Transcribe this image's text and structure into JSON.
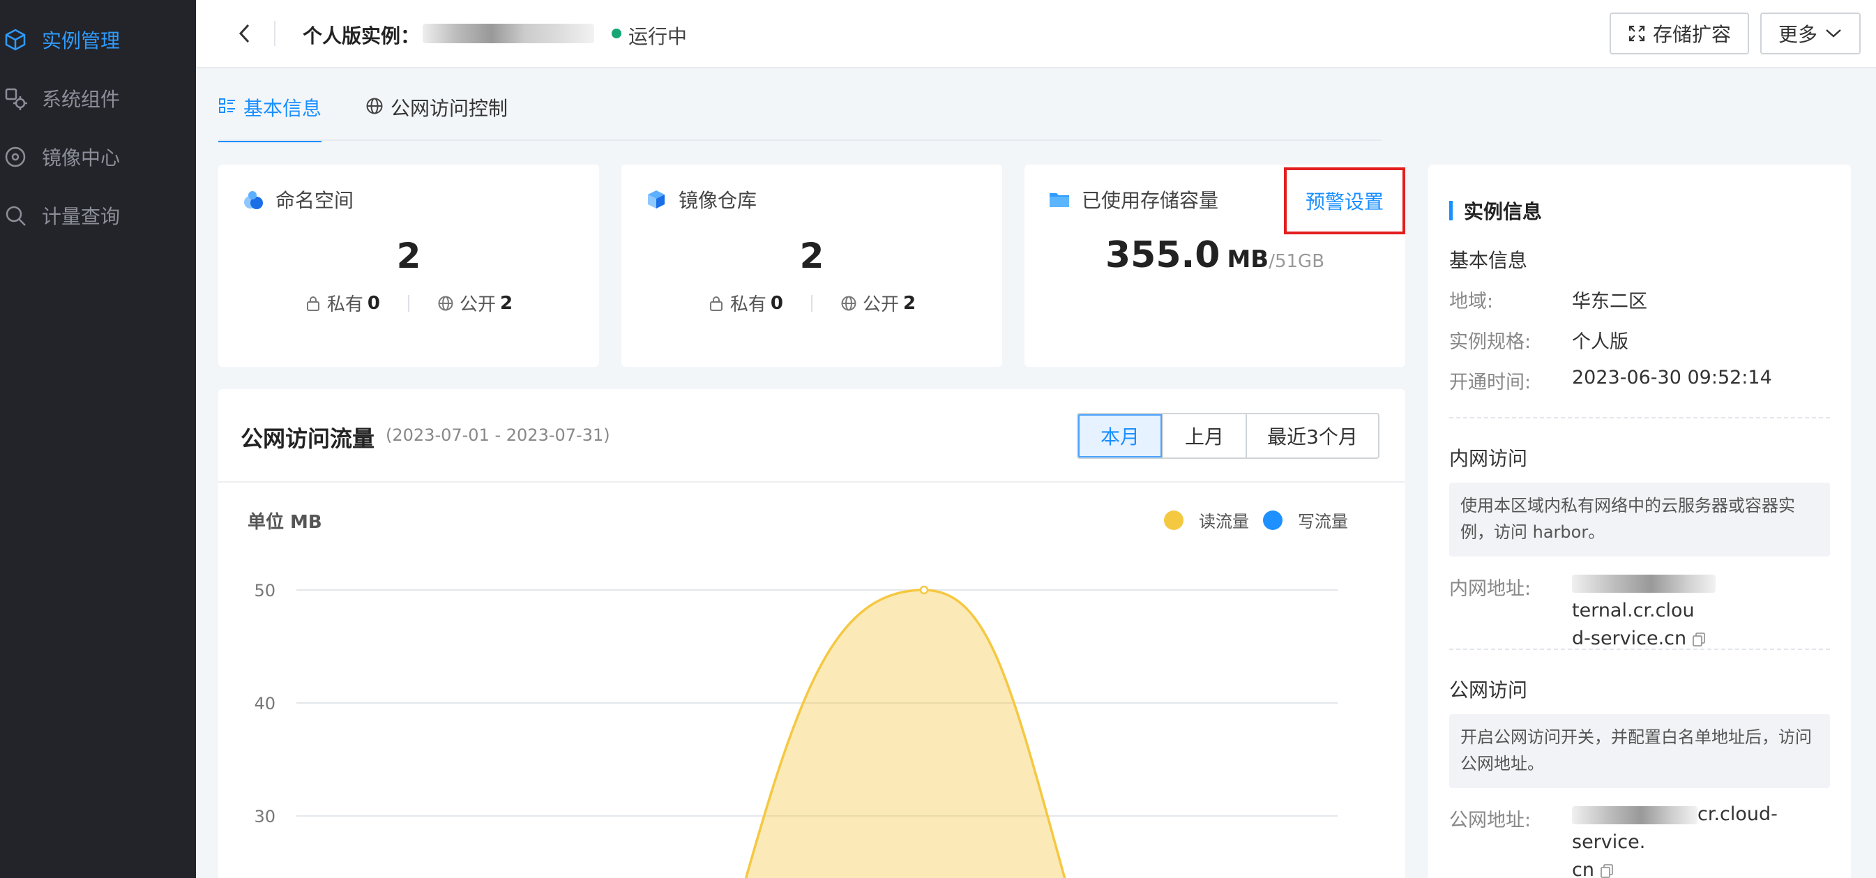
{
  "sidebar": {
    "items": [
      {
        "label": "实例管理",
        "icon": "instance-cube-icon",
        "active": true
      },
      {
        "label": "系统组件",
        "icon": "component-gear-icon",
        "active": false
      },
      {
        "label": "镜像中心",
        "icon": "image-disc-icon",
        "active": false
      },
      {
        "label": "计量查询",
        "icon": "search-icon",
        "active": false
      }
    ]
  },
  "header": {
    "title": "个人版实例：",
    "status": "运行中",
    "expand_label": "存储扩容",
    "more_label": "更多"
  },
  "tabs": [
    {
      "label": "基本信息",
      "icon": "list-icon",
      "active": true
    },
    {
      "label": "公网访问控制",
      "icon": "globe-icon",
      "active": false
    }
  ],
  "stats": {
    "namespace": {
      "title": "命名空间",
      "count": "2",
      "private_label": "私有",
      "private_count": "0",
      "public_label": "公开",
      "public_count": "2"
    },
    "repository": {
      "title": "镜像仓库",
      "count": "2",
      "private_label": "私有",
      "private_count": "0",
      "public_label": "公开",
      "public_count": "2"
    },
    "storage": {
      "title": "已使用存储容量",
      "alarm_link": "预警设置",
      "value": "355.0",
      "unit": "MB",
      "total": "/51GB"
    }
  },
  "traffic": {
    "title": "公网访问流量",
    "range": "(2023-07-01 - 2023-07-31)",
    "periods": [
      {
        "label": "本月",
        "active": true
      },
      {
        "label": "上月",
        "active": false
      },
      {
        "label": "最近3个月",
        "active": false
      }
    ]
  },
  "chart_data": {
    "type": "area",
    "unit_label": "单位 MB",
    "y_ticks": [
      30,
      40,
      50
    ],
    "ylim": [
      0,
      50
    ],
    "series": [
      {
        "name": "读流量",
        "color": "#f5c842",
        "peak": 50
      },
      {
        "name": "写流量",
        "color": "#1e90ff",
        "peak": 0
      }
    ],
    "grid": true,
    "legend_position": "top-right"
  },
  "info": {
    "title": "实例信息",
    "basic_title": "基本信息",
    "region_label": "地域:",
    "region_value": "华东二区",
    "spec_label": "实例规格:",
    "spec_value": "个人版",
    "time_label": "开通时间:",
    "time_value": "2023-06-30 09:52:14",
    "intranet_title": "内网访问",
    "intranet_note": "使用本区域内私有网络中的云服务器或容器实例，访问 harbor。",
    "intranet_label": "内网地址:",
    "intranet_addr_tail1": "ternal.cr.clou",
    "intranet_addr_tail2": "d-service.cn",
    "public_title": "公网访问",
    "public_note": "开启公网访问开关，并配置白名单地址后，访问公网地址。",
    "public_label": "公网地址:",
    "public_addr_tail1": "cr.cloud-service.",
    "public_addr_tail2": "cn"
  },
  "colors": {
    "accent": "#1a8fff",
    "sidebar_bg": "#232429",
    "running": "#15a675",
    "highlight_box": "#e21e1e"
  }
}
